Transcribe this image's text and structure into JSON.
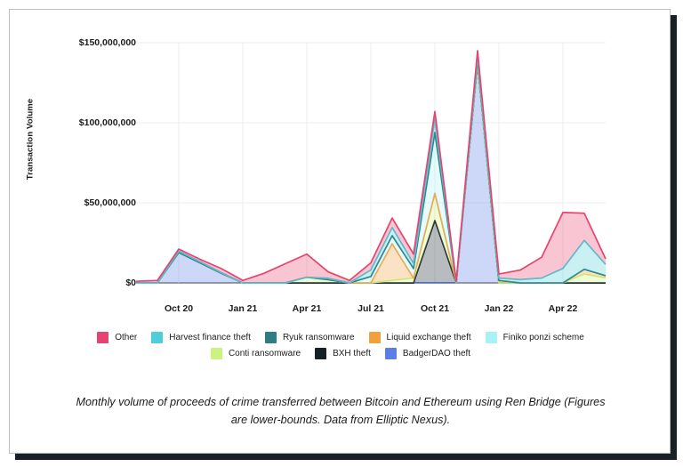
{
  "chart_data": {
    "type": "area",
    "stacked": true,
    "title": "",
    "xlabel": "",
    "ylabel": "Transaction Volume",
    "ylim": [
      0,
      150000000
    ],
    "grid": true,
    "legend_position": "bottom",
    "y_ticks": [
      "$0",
      "$50,000,000",
      "$100,000,000",
      "$150,000,000"
    ],
    "y_tick_values": [
      0,
      50000000,
      100000000,
      150000000
    ],
    "x_tick_labels": [
      "Oct 20",
      "Jan 21",
      "Apr 21",
      "Jul 21",
      "Oct 21",
      "Jan 22",
      "Apr 22"
    ],
    "categories": [
      "Aug 20",
      "Sep 20",
      "Oct 20",
      "Nov 20",
      "Dec 20",
      "Jan 21",
      "Feb 21",
      "Mar 21",
      "Apr 21",
      "May 21",
      "Jun 21",
      "Jul 21",
      "Aug 21",
      "Sep 21",
      "Oct 21",
      "Nov 21",
      "Dec 21",
      "Jan 22",
      "Feb 22",
      "Mar 22",
      "Apr 22",
      "May 22",
      "Jun 22"
    ],
    "series": [
      {
        "name": "BadgerDAO theft",
        "color": "#5b7fe8",
        "values": [
          0,
          0,
          19000000,
          12500000,
          6000000,
          0,
          0,
          0,
          0,
          0,
          0,
          0,
          0,
          0,
          0,
          0,
          137000000,
          0,
          0,
          0,
          0,
          0,
          0
        ]
      },
      {
        "name": "BXH theft",
        "color": "#142228",
        "values": [
          0,
          0,
          0,
          0,
          0,
          0,
          0,
          0,
          0,
          0,
          0,
          0,
          0,
          0,
          39000000,
          0,
          0,
          0,
          0,
          0,
          0,
          0,
          0
        ]
      },
      {
        "name": "Conti ransomware",
        "color": "#ccf37f",
        "values": [
          0,
          0,
          0,
          0,
          0,
          0,
          0,
          0,
          3500000,
          2000000,
          0,
          0,
          1500000,
          3000000,
          17000000,
          0,
          0,
          0,
          0,
          0,
          0,
          5500000,
          3000000
        ]
      },
      {
        "name": "Liquid exchange theft",
        "color": "#f2a03c",
        "values": [
          0,
          0,
          0,
          0,
          0,
          0,
          0,
          0,
          0,
          0,
          0,
          0,
          23000000,
          0,
          0,
          0,
          2500000,
          1500000,
          0,
          0,
          0,
          3000000,
          1500000
        ]
      },
      {
        "name": "Finiko ponzi scheme",
        "color": "#a8f2f7",
        "values": [
          0,
          0,
          0,
          0,
          0,
          0,
          0,
          0,
          0,
          0,
          0,
          4000000,
          5000000,
          6000000,
          38000000,
          0,
          0,
          0,
          0,
          0,
          0,
          0,
          0
        ]
      },
      {
        "name": "Ryuk ransomware",
        "color": "#2e7d82",
        "values": [
          0,
          0,
          0,
          0,
          0,
          0,
          0,
          0,
          0,
          0,
          0,
          0,
          0,
          0,
          0,
          0,
          0,
          0,
          0,
          0,
          0,
          0,
          0
        ]
      },
      {
        "name": "Harvest finance theft",
        "color": "#4ecddb",
        "values": [
          0,
          0,
          900000,
          700000,
          400000,
          0,
          0,
          0,
          0,
          900000,
          0,
          4000000,
          5000000,
          3000000,
          8000000,
          0,
          2000000,
          1500000,
          2000000,
          3000000,
          9000000,
          18000000,
          7000000
        ]
      },
      {
        "name": "Other",
        "color": "#e8436e",
        "values": [
          1000000,
          1500000,
          1200000,
          1500000,
          2500000,
          1500000,
          6000000,
          12000000,
          14500000,
          4000000,
          1500000,
          4500000,
          6000000,
          6000000,
          5000000,
          1000000,
          3500000,
          2500000,
          6000000,
          13000000,
          35000000,
          17000000,
          3500000
        ]
      }
    ]
  },
  "caption": {
    "line1": "Monthly volume of proceeds of crime transferred between Bitcoin and Ethereum",
    "line2": "using Ren Bridge (Figures are lower-bounds. Data from Elliptic Nexus)."
  },
  "legend": {
    "row1": [
      {
        "label": "Other",
        "color": "#e8436e"
      },
      {
        "label": "Harvest finance theft",
        "color": "#4ecddb"
      },
      {
        "label": "Ryuk ransomware",
        "color": "#2e7d82"
      },
      {
        "label": "Liquid exchange theft",
        "color": "#f2a03c"
      },
      {
        "label": "Finiko ponzi scheme",
        "color": "#a8f2f7"
      }
    ],
    "row2": [
      {
        "label": "Conti ransomware",
        "color": "#ccf37f"
      },
      {
        "label": "BXH theft",
        "color": "#142228"
      },
      {
        "label": "BadgerDAO theft",
        "color": "#5b7fe8"
      }
    ]
  }
}
